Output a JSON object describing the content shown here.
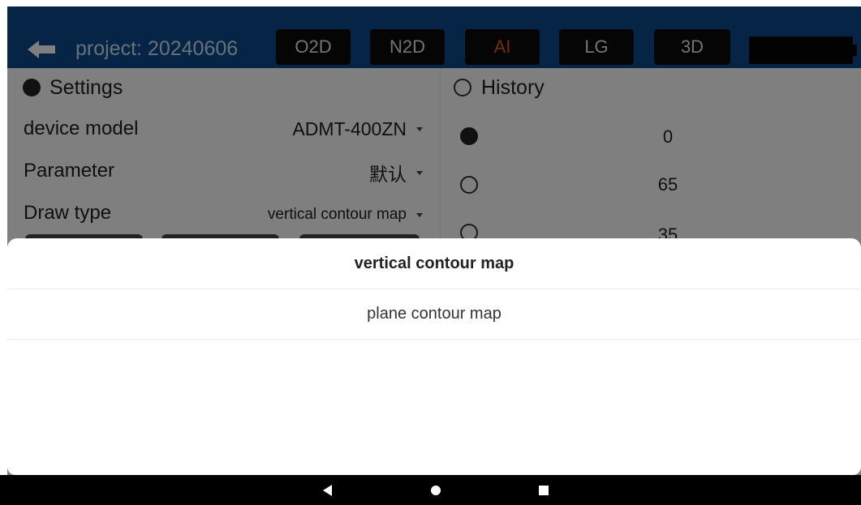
{
  "header": {
    "title": "project: 20240606",
    "tabs": [
      {
        "label": "O2D",
        "active": false
      },
      {
        "label": "N2D",
        "active": false
      },
      {
        "label": "AI",
        "active": true
      },
      {
        "label": "LG",
        "active": false
      },
      {
        "label": "3D",
        "active": false
      }
    ]
  },
  "settings": {
    "title": "Settings",
    "selected": true,
    "rows": [
      {
        "label": "device model",
        "value": "ADMT-400ZN"
      },
      {
        "label": "Parameter",
        "value": "默认"
      },
      {
        "label": "Draw type",
        "value": "vertical contour map"
      }
    ]
  },
  "history": {
    "title": "History",
    "selected": false,
    "items": [
      {
        "value": "0",
        "selected": true
      },
      {
        "value": "65",
        "selected": false
      },
      {
        "value": "35",
        "selected": false
      }
    ]
  },
  "sheet": {
    "options": [
      {
        "label": "vertical contour map",
        "selected": true
      },
      {
        "label": "plane contour map",
        "selected": false
      }
    ]
  },
  "icons": {
    "back": "arrow-left-icon",
    "battery": "battery-icon",
    "nav_back": "triangle-back-icon",
    "nav_home": "circle-home-icon",
    "nav_recent": "square-recent-icon"
  },
  "colors": {
    "header_bg": "#0d4a8c",
    "active_tab_text": "#e8562e",
    "overlay": "rgba(0,0,0,0.5)"
  }
}
